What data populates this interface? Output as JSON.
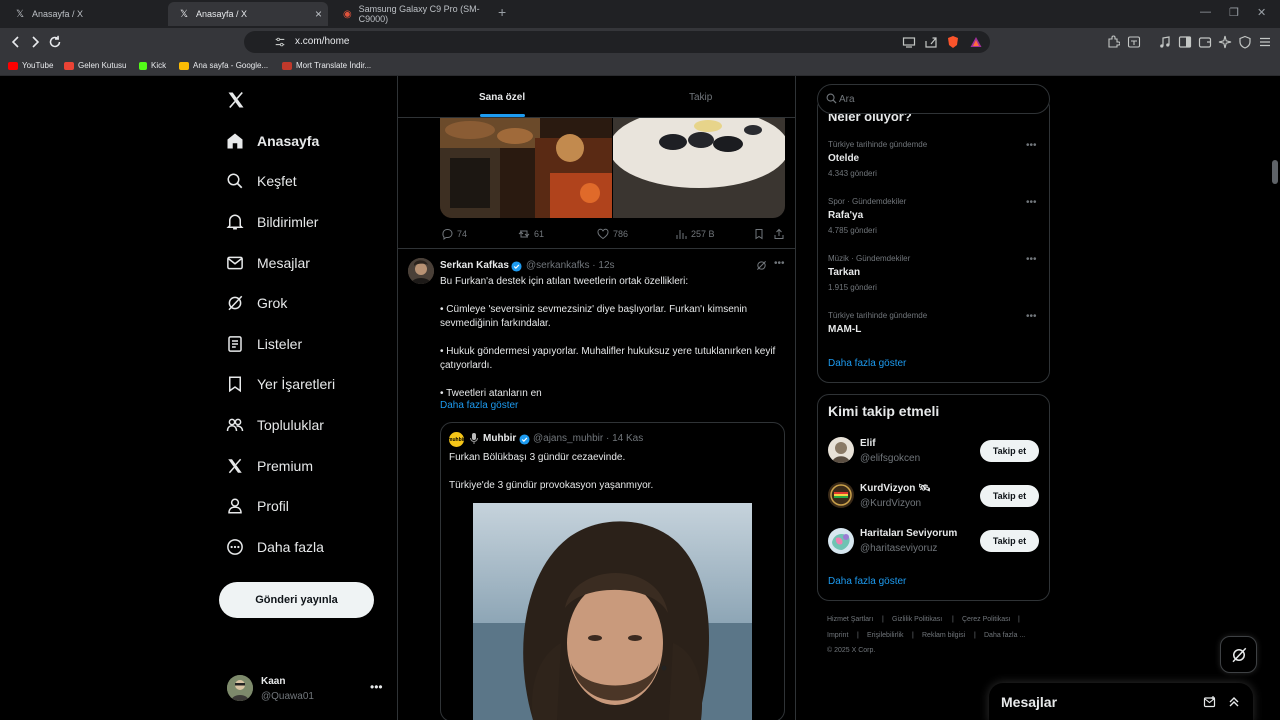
{
  "browser": {
    "tabs": [
      {
        "title": "Anasayfa / X"
      },
      {
        "title": "Anasayfa / X"
      },
      {
        "title": "Samsung Galaxy C9 Pro (SM-C9000)"
      }
    ],
    "url": "x.com/home",
    "bookmarks": [
      {
        "label": "YouTube",
        "color": "#ff0000"
      },
      {
        "label": "Gelen Kutusu",
        "color": "#ea4335"
      },
      {
        "label": "Kick",
        "color": "#53fc18"
      },
      {
        "label": "Ana sayfa - Google...",
        "color": "#fbbc04"
      },
      {
        "label": "Mort Translate İndir...",
        "color": "#c0392b"
      }
    ]
  },
  "nav": {
    "items": [
      {
        "label": "Anasayfa",
        "icon": "home-icon"
      },
      {
        "label": "Keşfet",
        "icon": "search-icon"
      },
      {
        "label": "Bildirimler",
        "icon": "bell-icon"
      },
      {
        "label": "Mesajlar",
        "icon": "mail-icon"
      },
      {
        "label": "Grok",
        "icon": "grok-icon"
      },
      {
        "label": "Listeler",
        "icon": "list-icon"
      },
      {
        "label": "Yer İşaretleri",
        "icon": "bookmark-icon"
      },
      {
        "label": "Topluluklar",
        "icon": "communities-icon"
      },
      {
        "label": "Premium",
        "icon": "x-logo-icon"
      },
      {
        "label": "Profil",
        "icon": "profile-icon"
      },
      {
        "label": "Daha fazla",
        "icon": "more-circle-icon"
      }
    ],
    "post_button": "Gönderi yayınla",
    "account": {
      "name": "Kaan",
      "handle": "@Quawa01"
    }
  },
  "timeline": {
    "tabs": [
      {
        "label": "Sana özel"
      },
      {
        "label": "Takip"
      }
    ],
    "prev_tweet_actions": {
      "replies": "74",
      "retweets": "61",
      "likes": "786",
      "views": "257 B"
    },
    "tweet": {
      "name": "Serkan Kafkas",
      "handle": "@serkankafks",
      "time": "· 12s",
      "lines": [
        "Bu Furkan'a destek için atılan tweetlerin ortak özellikleri:",
        "• Cümleye 'seversiniz sevmezsiniz' diye başlıyorlar. Furkan'ı kimsenin",
        "sevmediğinin farkındalar.",
        "• Hukuk göndermesi yapıyorlar. Muhalifler hukuksuz yere tutuklanırken keyif",
        "çatıyorlardı.",
        "• Tweetleri atanların en"
      ],
      "show_more": "Daha fazla göster",
      "quote": {
        "avatar_text": "muhbir",
        "name": "Muhbir",
        "handle": "@ajans_muhbir",
        "time": "· 14 Kas",
        "lines": [
          "Furkan Bölükbaşı 3 gündür cezaevinde.",
          "Türkiye'de 3 gündür provokasyon yaşanmıyor."
        ]
      }
    }
  },
  "sidebar": {
    "search_placeholder": "Ara",
    "trends_title": "Neler oluyor?",
    "trends": [
      {
        "context": "Türkiye tarihinde gündemde",
        "name": "Otelde",
        "count": "4.343 gönderi"
      },
      {
        "context": "Spor · Gündemdekiler",
        "name": "Rafa'ya",
        "count": "4.785 gönderi"
      },
      {
        "context": "Müzik · Gündemdekiler",
        "name": "Tarkan",
        "count": "1.915 gönderi"
      },
      {
        "context": "Türkiye tarihinde gündemde",
        "name": "MAM-L",
        "count": ""
      }
    ],
    "trends_show_more": "Daha fazla göster",
    "who_to_follow_title": "Kimi takip etmeli",
    "suggestions": [
      {
        "name": "Elif",
        "handle": "@elifsgokcen",
        "button": "Takip et",
        "color": "#8a7a66"
      },
      {
        "name": "KurdVizyon",
        "emoji": "🛰",
        "handle": "@KurdVizyon",
        "button": "Takip et",
        "color": "#3a2a18"
      },
      {
        "name": "Haritaları Seviyorum",
        "handle": "@haritaseviyoruz",
        "button": "Takip et",
        "color": "#d7e7f0"
      }
    ],
    "follow_show_more": "Daha fazla göster",
    "footer": [
      "Hizmet Şartları",
      "Gizlilik Politikası",
      "Çerez Politikası",
      "Imprint",
      "Erişilebilirlik",
      "Reklam bilgisi",
      "Daha fazla ...",
      "© 2025 X Corp."
    ],
    "messages_drawer": "Mesajlar"
  }
}
